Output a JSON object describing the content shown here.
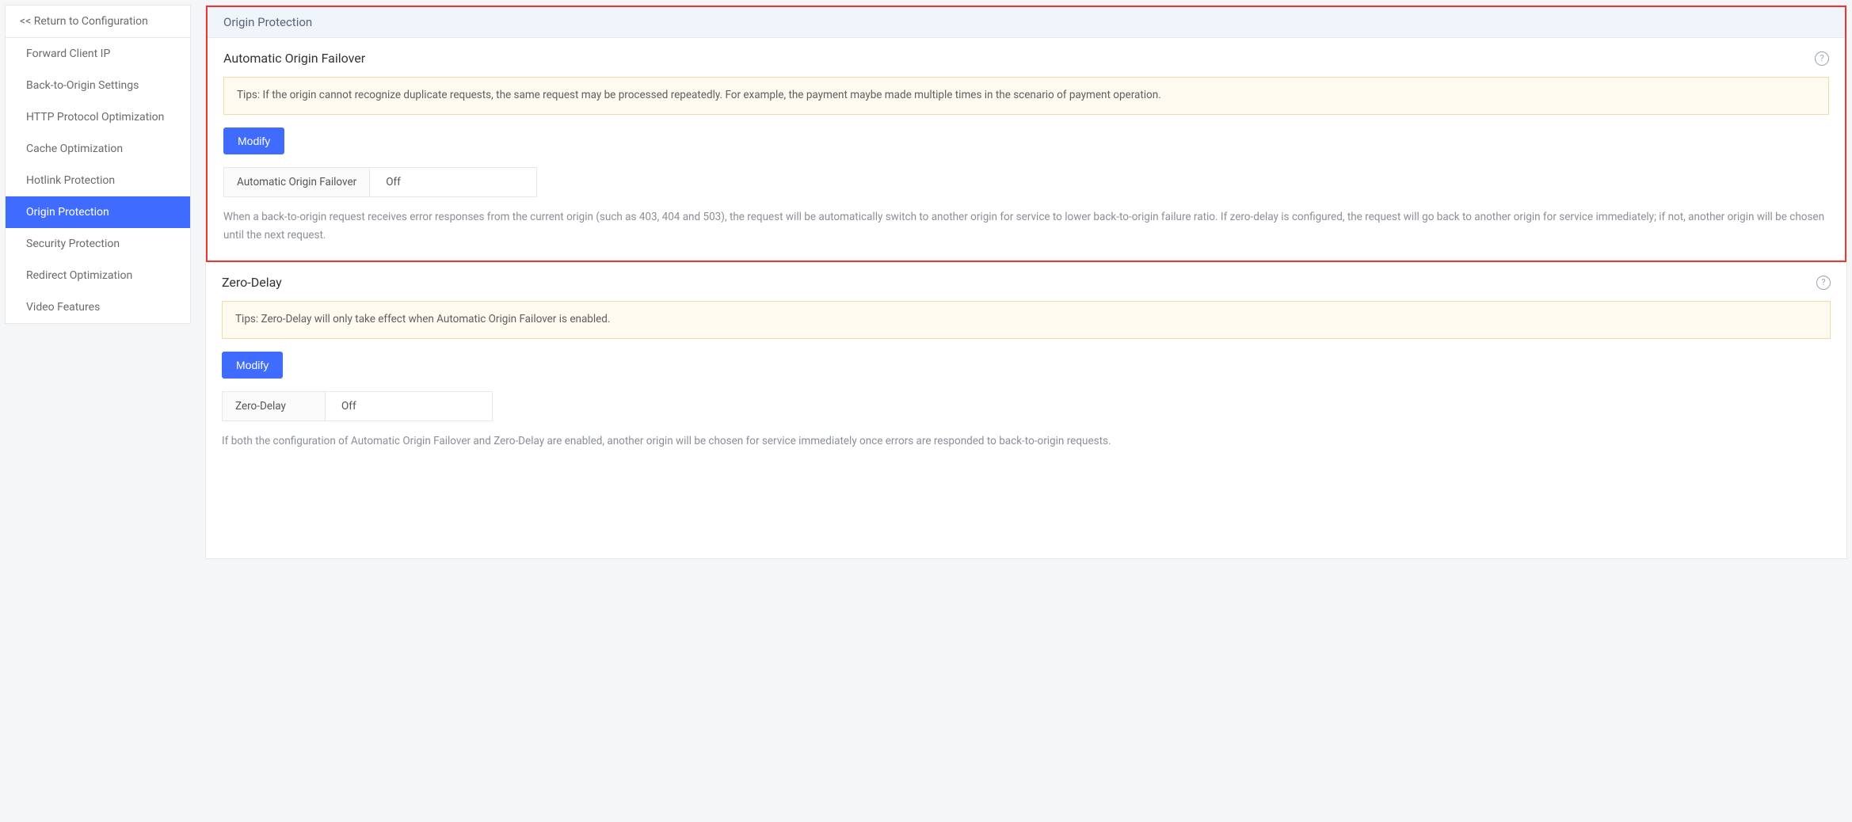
{
  "sidebar": {
    "return": "<< Return to Configuration",
    "items": [
      {
        "label": "Forward Client IP",
        "active": false
      },
      {
        "label": "Back-to-Origin Settings",
        "active": false
      },
      {
        "label": "HTTP Protocol Optimization",
        "active": false
      },
      {
        "label": "Cache Optimization",
        "active": false
      },
      {
        "label": "Hotlink Protection",
        "active": false
      },
      {
        "label": "Origin Protection",
        "active": true
      },
      {
        "label": "Security Protection",
        "active": false
      },
      {
        "label": "Redirect Optimization",
        "active": false
      },
      {
        "label": "Video Features",
        "active": false
      }
    ]
  },
  "main": {
    "header": "Origin Protection",
    "section_failover": {
      "title": "Automatic Origin Failover",
      "tip": "Tips: If the origin cannot recognize duplicate requests, the same request may be processed repeatedly. For example, the payment maybe made multiple times in the scenario of payment operation.",
      "modify": "Modify",
      "row_label": "Automatic Origin Failover",
      "row_value": "Off",
      "description": "When a back-to-origin request receives error responses from the current origin (such as 403, 404 and 503), the request will be automatically switch to another origin for service to lower back-to-origin failure ratio. If zero-delay is configured, the request will go back to another origin for service immediately; if not, another origin will be chosen until the next request."
    },
    "section_zerodelay": {
      "title": "Zero-Delay",
      "tip": "Tips: Zero-Delay will only take effect when Automatic Origin Failover is enabled.",
      "modify": "Modify",
      "row_label": "Zero-Delay",
      "row_value": "Off",
      "description": "If both the configuration of Automatic Origin Failover and Zero-Delay are enabled, another origin will be chosen for service immediately once errors are responded to back-to-origin requests."
    }
  }
}
